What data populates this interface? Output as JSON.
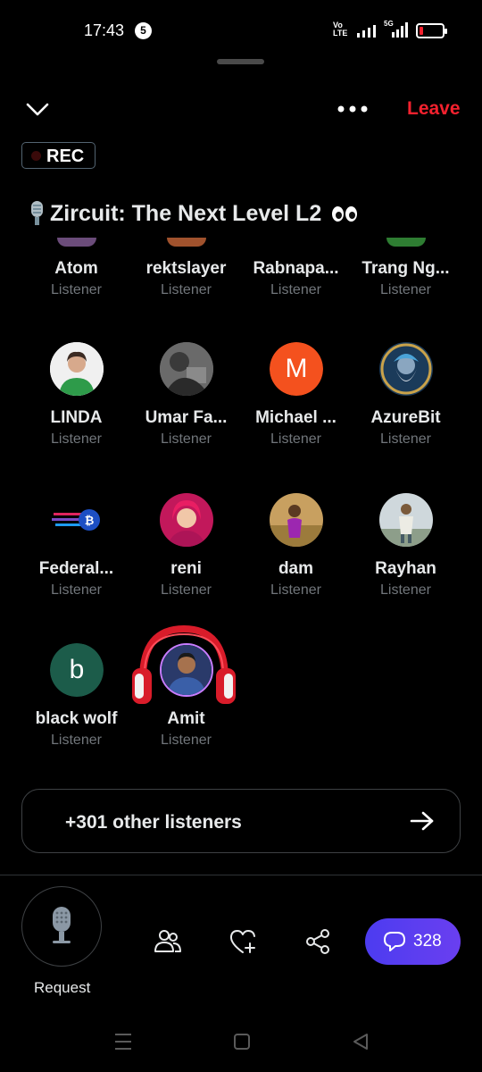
{
  "status_bar": {
    "time": "17:43",
    "notification_count": "5",
    "volte": "Vo\nLTE",
    "network": "5G",
    "battery_level": 0.1
  },
  "header": {
    "leave_label": "Leave",
    "rec_label": "REC"
  },
  "space": {
    "title": "Zircuit: The Next Level L2",
    "title_icon": "microphone-emoji",
    "title_suffix": "eyes-emoji"
  },
  "participants": [
    {
      "name": "Atom",
      "role": "Listener"
    },
    {
      "name": "rektslayer",
      "role": "Listener"
    },
    {
      "name": "Rabnapa...",
      "role": "Listener"
    },
    {
      "name": "Trang Ng...",
      "role": "Listener"
    },
    {
      "name": "LINDA",
      "role": "Listener"
    },
    {
      "name": "Umar Fa...",
      "role": "Listener"
    },
    {
      "name": "Michael ...",
      "role": "Listener",
      "avatar_letter": "M",
      "avatar_color": "#f4511e"
    },
    {
      "name": "AzureBit",
      "role": "Listener"
    },
    {
      "name": "Federal...",
      "role": "Listener"
    },
    {
      "name": "reni",
      "role": "Listener"
    },
    {
      "name": "dam",
      "role": "Listener"
    },
    {
      "name": "Rayhan",
      "role": "Listener"
    },
    {
      "name": "black wolf",
      "role": "Listener",
      "avatar_letter": "b",
      "avatar_color": "#1c5c4a"
    },
    {
      "name": "Amit",
      "role": "Listener"
    }
  ],
  "others": {
    "label": "+301 other listeners"
  },
  "bottom_bar": {
    "request_label": "Request",
    "comment_count": "328"
  },
  "colors": {
    "leave": "#f4212e",
    "comment_button": "#5a3cf0",
    "background": "#000000"
  }
}
